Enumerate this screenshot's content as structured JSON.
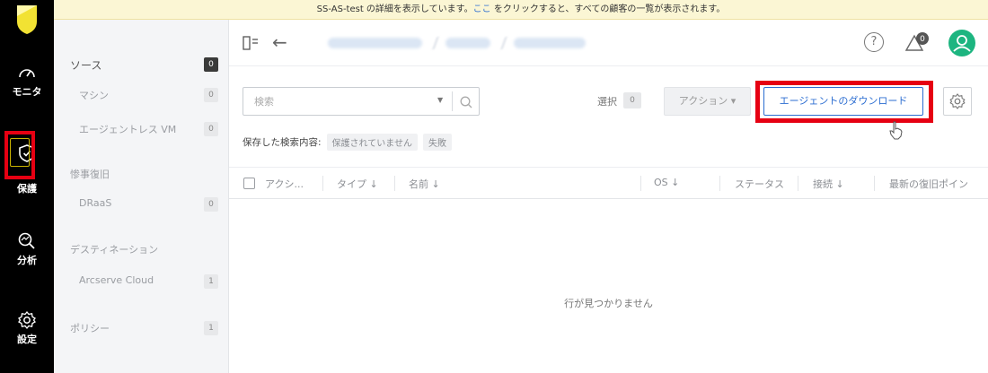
{
  "notice": {
    "before": "SS-AS-test の詳細を表示しています。",
    "link": "ここ",
    "after": " をクリックすると、すべての顧客の一覧が表示されます。"
  },
  "rail": {
    "items": [
      {
        "label": "モニタ",
        "icon": "gauge-icon"
      },
      {
        "label": "保護",
        "icon": "shield-icon"
      },
      {
        "label": "分析",
        "icon": "analytics-icon"
      },
      {
        "label": "設定",
        "icon": "gear-icon"
      }
    ],
    "active_highlight_color": "#e60012"
  },
  "sidebar": {
    "items": [
      {
        "label": "ソース",
        "count": "0",
        "kind": "head"
      },
      {
        "label": "マシン",
        "count": "0",
        "kind": "sub"
      },
      {
        "label": "エージェントレス VM",
        "count": "0",
        "kind": "sub"
      },
      {
        "label": "惨事復旧",
        "kind": "cat"
      },
      {
        "label": "DRaaS",
        "count": "0",
        "kind": "sub"
      },
      {
        "label": "デスティネーション",
        "kind": "cat"
      },
      {
        "label": "Arcserve Cloud",
        "count": "1",
        "kind": "sub"
      },
      {
        "label": "ポリシー",
        "count": "1",
        "kind": "cat"
      }
    ]
  },
  "topbar": {
    "help_symbol": "?",
    "alert_count": "0"
  },
  "toolbar": {
    "search_placeholder": "検索",
    "select_label": "選択",
    "select_count": "0",
    "action_label": "アクション ▾",
    "download_label": "エージェントのダウンロード"
  },
  "saved_search": {
    "label": "保存した検索内容:",
    "chips": [
      "保護されていません",
      "失敗"
    ]
  },
  "table": {
    "columns": [
      "アクシ...",
      "タイプ ↓",
      "名前 ↓",
      "OS ↓",
      "ステータス",
      "接続 ↓",
      "最新の復旧ポイン"
    ],
    "empty_message": "行が見つかりません"
  },
  "colors": {
    "accent": "#2b6dd1",
    "highlight": "#e60012",
    "notice_bg": "#fbf6d4",
    "avatar": "#1db580",
    "logo": "#f2e233"
  }
}
